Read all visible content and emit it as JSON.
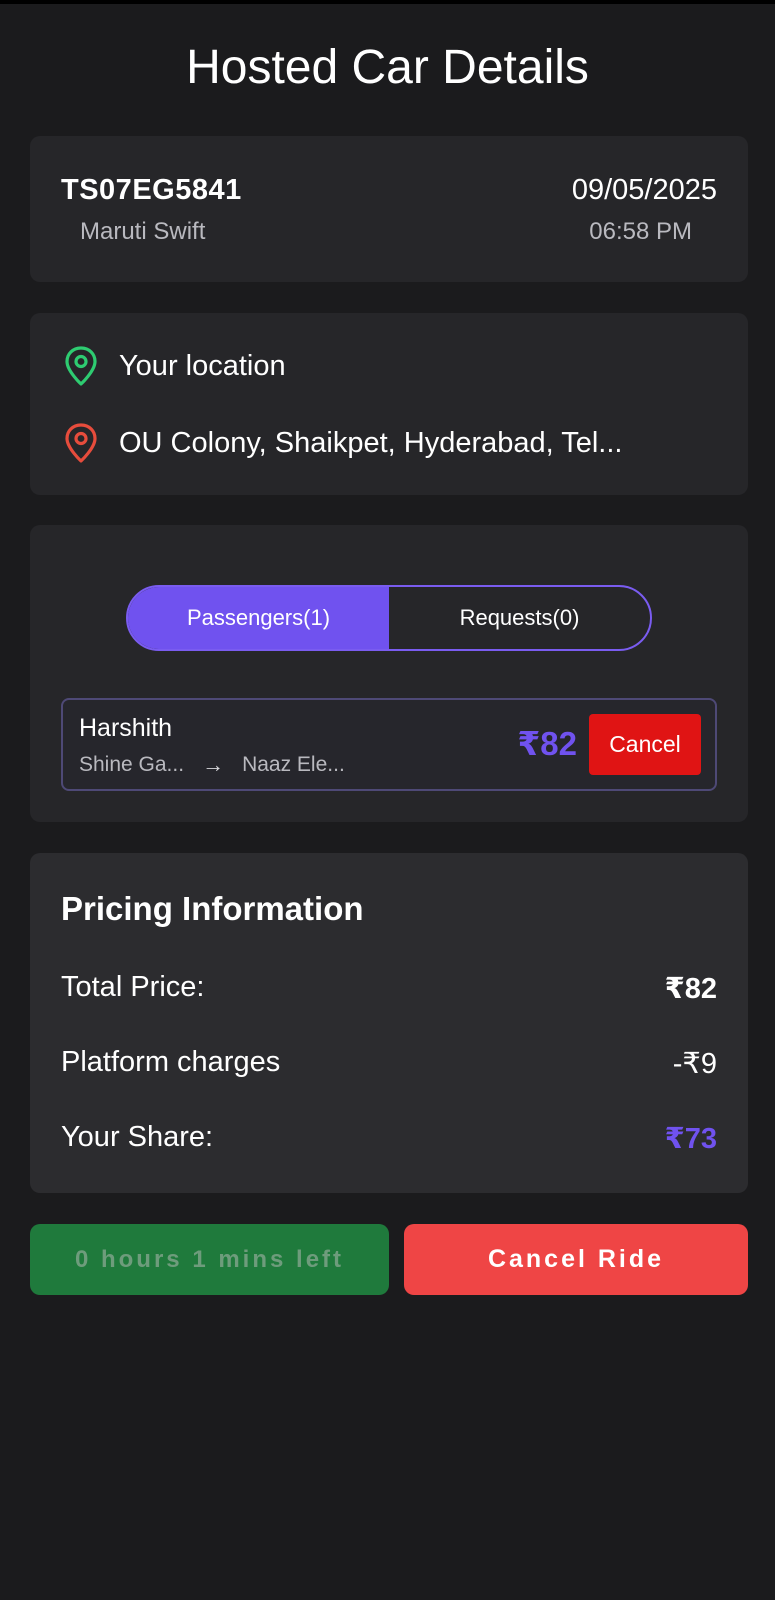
{
  "header": {
    "title": "Hosted Car Details"
  },
  "car": {
    "plate": "TS07EG5841",
    "model": "Maruti Swift",
    "date": "09/05/2025",
    "time": "06:58 PM"
  },
  "locations": {
    "pickup": {
      "label": "Your location",
      "icon": "location-pin-icon",
      "color": "#2ecc71"
    },
    "dropoff": {
      "label": "OU Colony, Shaikpet, Hyderabad, Tel...",
      "icon": "location-pin-icon",
      "color": "#e74c3c"
    }
  },
  "tabs": {
    "passengers": "Passengers(1)",
    "requests": "Requests(0)",
    "active": "passengers"
  },
  "passengers": [
    {
      "name": "Harshith",
      "from": "Shine Ga...",
      "to": "Naaz Ele...",
      "fare": "₹82",
      "cancel_label": "Cancel"
    }
  ],
  "pricing": {
    "title": "Pricing Information",
    "total_label": "Total Price:",
    "total_value": "₹82",
    "platform_label": "Platform charges",
    "platform_value": "-₹9",
    "share_label": "Your Share:",
    "share_value": "₹73"
  },
  "actions": {
    "timer_label": "0 hours 1 mins left",
    "cancel_ride_label": "Cancel Ride"
  },
  "colors": {
    "accent": "#7052ef",
    "danger": "#e01414",
    "cancel_ride": "#ef4545",
    "timer_bg": "#1f7a3c"
  }
}
